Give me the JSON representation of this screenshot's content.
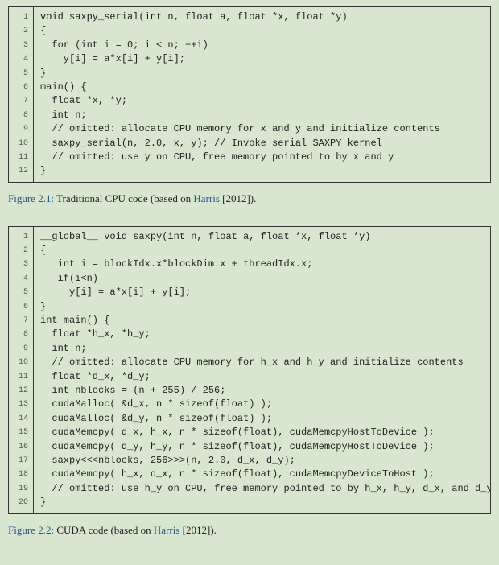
{
  "listing1": {
    "lines": [
      "void saxpy_serial(int n, float a, float *x, float *y)",
      "{",
      "  for (int i = 0; i < n; ++i)",
      "    y[i] = a*x[i] + y[i];",
      "}",
      "main() {",
      "  float *x, *y;",
      "  int n;",
      "  // omitted: allocate CPU memory for x and y and initialize contents",
      "  saxpy_serial(n, 2.0, x, y); // Invoke serial SAXPY kernel",
      "  // omitted: use y on CPU, free memory pointed to by x and y",
      "}"
    ]
  },
  "caption1": {
    "label": "Figure 2.1:",
    "text_before": " Traditional CPU code (based on ",
    "link": "Harris",
    "text_after": " [2012])."
  },
  "listing2": {
    "lines": [
      "__global__ void saxpy(int n, float a, float *x, float *y)",
      "{",
      "   int i = blockIdx.x*blockDim.x + threadIdx.x;",
      "   if(i<n)",
      "     y[i] = a*x[i] + y[i];",
      "}",
      "int main() {",
      "  float *h_x, *h_y;",
      "  int n;",
      "  // omitted: allocate CPU memory for h_x and h_y and initialize contents",
      "  float *d_x, *d_y;",
      "  int nblocks = (n + 255) / 256;",
      "  cudaMalloc( &d_x, n * sizeof(float) );",
      "  cudaMalloc( &d_y, n * sizeof(float) );",
      "  cudaMemcpy( d_x, h_x, n * sizeof(float), cudaMemcpyHostToDevice );",
      "  cudaMemcpy( d_y, h_y, n * sizeof(float), cudaMemcpyHostToDevice );",
      "  saxpy<<<nblocks, 256>>>(n, 2.0, d_x, d_y);",
      "  cudaMemcpy( h_x, d_x, n * sizeof(float), cudaMemcpyDeviceToHost );",
      "  // omitted: use h_y on CPU, free memory pointed to by h_x, h_y, d_x, and d_y",
      "}"
    ]
  },
  "caption2": {
    "label": "Figure 2.2:",
    "text_before": " CUDA code (based on ",
    "link": "Harris",
    "text_after": " [2012])."
  }
}
